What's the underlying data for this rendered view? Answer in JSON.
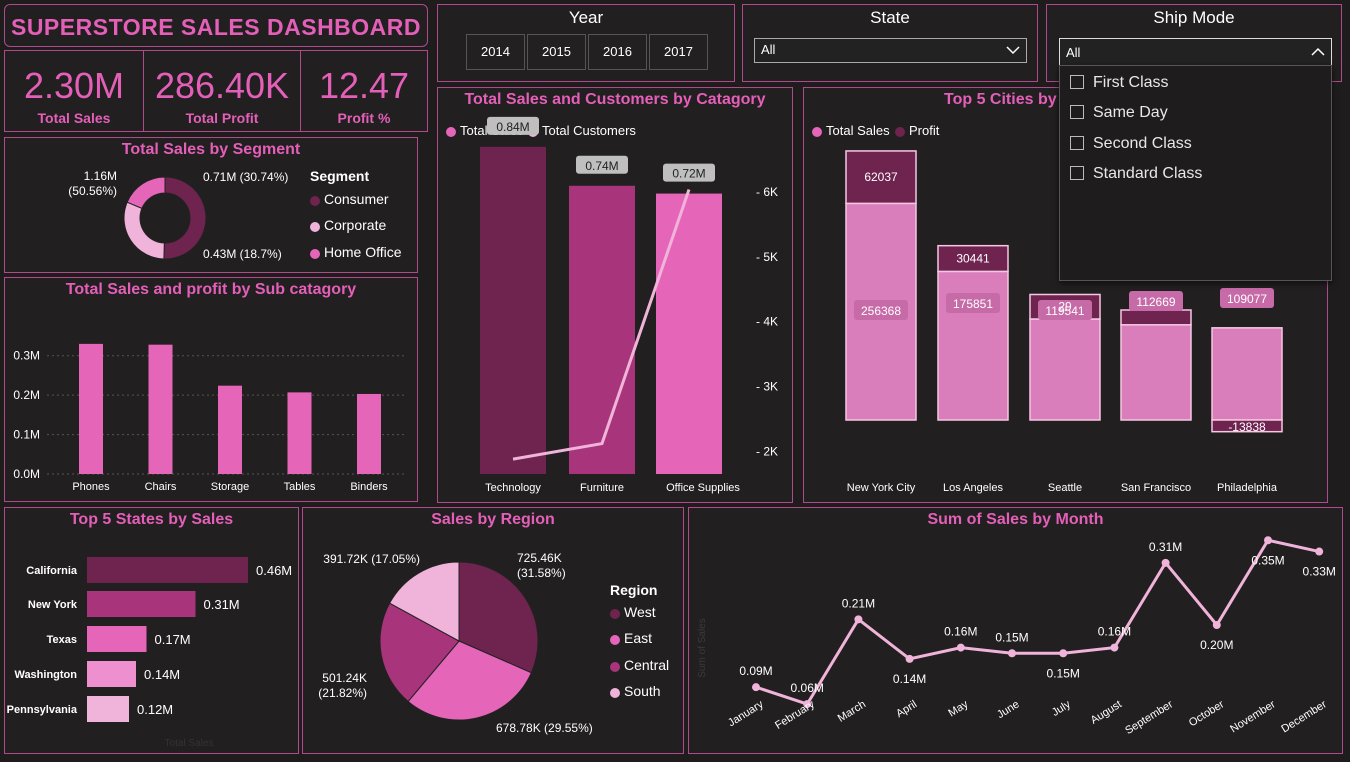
{
  "header": {
    "title": "SUPERSTORE SALES DASHBOARD"
  },
  "kpis": [
    {
      "value": "2.30M",
      "label": "Total Sales"
    },
    {
      "value": "286.40K",
      "label": "Total Profit"
    },
    {
      "value": "12.47",
      "label": "Profit %"
    }
  ],
  "slicers": {
    "year": {
      "title": "Year",
      "options": [
        "2014",
        "2015",
        "2016",
        "2017"
      ]
    },
    "state": {
      "title": "State",
      "value": "All"
    },
    "ship_mode": {
      "title": "Ship Mode",
      "value": "All",
      "options": [
        "First Class",
        "Same Day",
        "Second Class",
        "Standard Class"
      ]
    }
  },
  "colors": {
    "dark": "#6f234f",
    "mid": "#a8347c",
    "bright": "#e565b9",
    "light": "#f0b3d9",
    "panel_border": "#b04a8a",
    "title": "#e45fb8",
    "bg": "#1e1c1d"
  },
  "chart_data": [
    {
      "id": "segment",
      "type": "pie",
      "title": "Total Sales by Segment",
      "legend_title": "Segment",
      "categories": [
        "Consumer",
        "Corporate",
        "Home Office"
      ],
      "values": [
        1.16,
        0.71,
        0.43
      ],
      "labels": [
        "1.16M\n(50.56%)",
        "0.71M (30.74%)",
        "0.43M (18.7%)"
      ],
      "colors": [
        "#6f234f",
        "#f0b3d9",
        "#e565b9"
      ],
      "legend_position": "right"
    },
    {
      "id": "subcategory",
      "type": "bar",
      "title": "Total Sales and profit by Sub catagory",
      "categories": [
        "Phones",
        "Chairs",
        "Storage",
        "Tables",
        "Binders"
      ],
      "values": [
        0.33,
        0.328,
        0.224,
        0.207,
        0.203
      ],
      "yticks": [
        "0.0M",
        "0.1M",
        "0.2M",
        "0.3M"
      ],
      "ylim": [
        0,
        0.35
      ],
      "grid": true
    },
    {
      "id": "category",
      "type": "bar",
      "title": "Total Sales and Customers by Catagory",
      "categories": [
        "Technology",
        "Furniture",
        "Office Supplies"
      ],
      "series": [
        {
          "name": "Total Sales",
          "values": [
            0.84,
            0.74,
            0.72
          ],
          "labels": [
            "0.84M",
            "0.74M",
            "0.72M"
          ]
        },
        {
          "name": "Total Customers",
          "values": [
            1880,
            2120,
            6040
          ]
        }
      ],
      "bar_colors": [
        "#6f234f",
        "#a8347c",
        "#e565b9"
      ],
      "ylim": [
        0,
        0.95
      ],
      "y2ticks": [
        "2K",
        "3K",
        "4K",
        "5K",
        "6K"
      ],
      "y2lim": [
        1650,
        6650
      ]
    },
    {
      "id": "cities",
      "type": "bar",
      "title": "Top 5 Cities by",
      "categories": [
        "New York City",
        "Los Angeles",
        "Seattle",
        "San Francisco",
        "Philadelphia"
      ],
      "series": [
        {
          "name": "Total Sales",
          "values": [
            256368,
            175851,
            119541,
            112669,
            109077
          ],
          "labels": [
            "256368",
            "175851",
            "119541",
            "112669",
            "109077"
          ]
        },
        {
          "name": "Profit",
          "values": [
            62037,
            30441,
            29000,
            17500,
            -13838
          ],
          "labels": [
            "62037",
            "30441",
            "29",
            "",
            "-13838"
          ]
        }
      ],
      "stacked": true
    },
    {
      "id": "states",
      "type": "bar",
      "orientation": "horizontal",
      "title": "Top 5 States by Sales",
      "xlabel": "Total Sales",
      "categories": [
        "California",
        "New York",
        "Texas",
        "Washington",
        "Pennsylvania"
      ],
      "values": [
        0.46,
        0.31,
        0.17,
        0.14,
        0.12
      ],
      "labels": [
        "0.46M",
        "0.31M",
        "0.17M",
        "0.14M",
        "0.12M"
      ],
      "colors": [
        "#6f234f",
        "#a8347c",
        "#e565b9",
        "#ee8fcf",
        "#f0b3d9"
      ]
    },
    {
      "id": "region",
      "type": "pie",
      "title": "Sales by Region",
      "legend_title": "Region",
      "categories": [
        "West",
        "East",
        "Central",
        "South"
      ],
      "values": [
        725.46,
        678.78,
        501.24,
        391.72
      ],
      "labels": [
        "725.46K\n(31.58%)",
        "678.78K (29.55%)",
        "501.24K\n(21.82%)",
        "391.72K (17.05%)"
      ],
      "colors": [
        "#6f234f",
        "#e565b9",
        "#a8347c",
        "#f0b3d9"
      ],
      "legend_position": "right"
    },
    {
      "id": "month",
      "type": "line",
      "title": "Sum of Sales by Month",
      "ylabel": "Sum of Sales",
      "categories": [
        "January",
        "February",
        "March",
        "April",
        "May",
        "June",
        "July",
        "August",
        "September",
        "October",
        "November",
        "December"
      ],
      "values": [
        0.09,
        0.06,
        0.21,
        0.14,
        0.16,
        0.15,
        0.15,
        0.16,
        0.31,
        0.2,
        0.35,
        0.33
      ],
      "labels": [
        "0.09M",
        "0.06M",
        "0.21M",
        "0.14M",
        "0.16M",
        "0.15M",
        "0.15M",
        "0.16M",
        "0.31M",
        "0.20M",
        "0.35M",
        "0.33M"
      ],
      "color": "#f0b3d9"
    }
  ]
}
